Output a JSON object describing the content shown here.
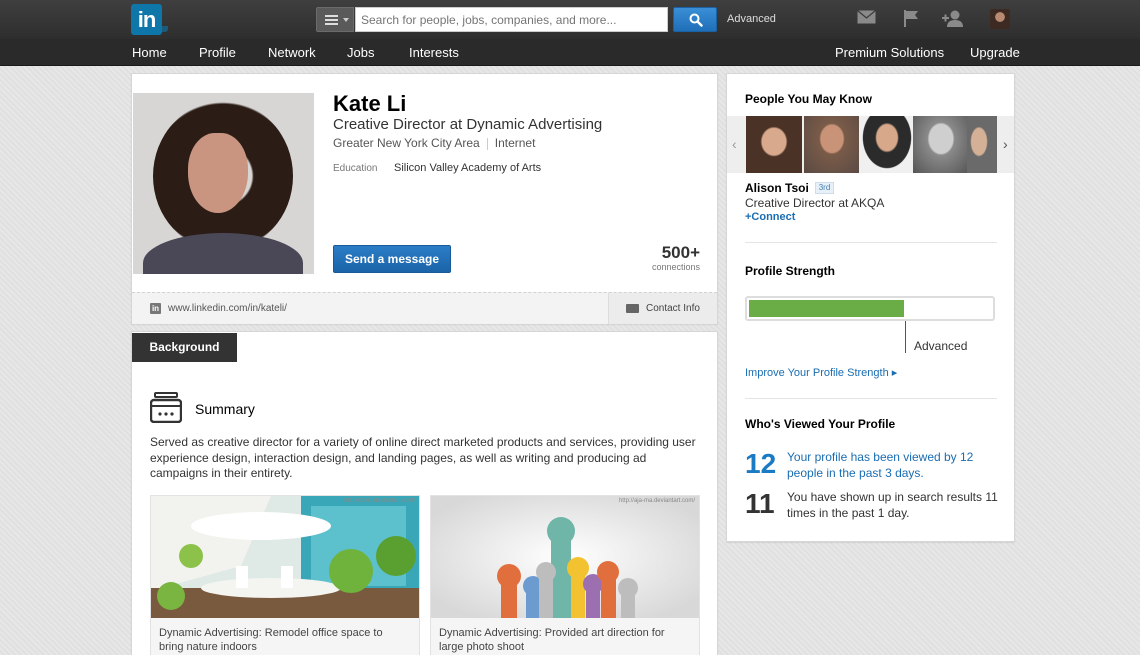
{
  "topbar": {
    "logo": "in",
    "search_placeholder": "Search for people, jobs, companies, and more...",
    "advanced": "Advanced",
    "icons": [
      "mail-icon",
      "flag-icon",
      "add-connection-icon"
    ]
  },
  "nav": {
    "left": [
      "Home",
      "Profile",
      "Network",
      "Jobs",
      "Interests"
    ],
    "right": [
      "Premium Solutions",
      "Upgrade"
    ]
  },
  "profile": {
    "name": "Kate Li",
    "headline": "Creative Director at Dynamic Advertising",
    "location": "Greater New York City Area",
    "industry": "Internet",
    "education_label": "Education",
    "education_value": "Silicon Valley Academy of Arts",
    "message_button": "Send a message",
    "connections_count": "500+",
    "connections_label": "connections",
    "url": "www.linkedin.com/in/kateli/",
    "contact_info": "Contact Info"
  },
  "background": {
    "tab": "Background",
    "summary_title": "Summary",
    "summary_text": "Served as creative director for a variety of online direct marketed products and services, providing user experience design, interaction design, and landing pages, as well as writing and producing ad campaigns in their entirety.",
    "media": [
      {
        "caption": "Dynamic Advertising: Remodel office space to bring nature indoors",
        "watermark": "http://tonio.deviantart.com/"
      },
      {
        "caption": "Dynamic Advertising: Provided art direction for large photo shoot",
        "watermark": "http://aja-ma.deviantart.com/"
      }
    ]
  },
  "sidebar": {
    "pymk_title": "People You May Know",
    "pymk_name": "Alison Tsoi",
    "pymk_degree": "3rd",
    "pymk_headline": "Creative Director at AKQA",
    "pymk_connect": "+Connect",
    "strength_title": "Profile Strength",
    "strength_level": 0.64,
    "strength_label": "Advanced",
    "improve_link": "Improve Your Profile Strength ▸",
    "viewed_title": "Who's Viewed Your Profile",
    "stat1_num": "12",
    "stat1_text": "Your profile has been viewed by 12 people in the past 3 days.",
    "stat2_num": "11",
    "stat2_text": "You have shown up in search results 11 times in the past 1 day."
  },
  "colors": {
    "brand": "#0e76a8",
    "link": "#1a6db2",
    "strength_green": "#6aac45",
    "stat_blue": "#1a7ac4"
  }
}
